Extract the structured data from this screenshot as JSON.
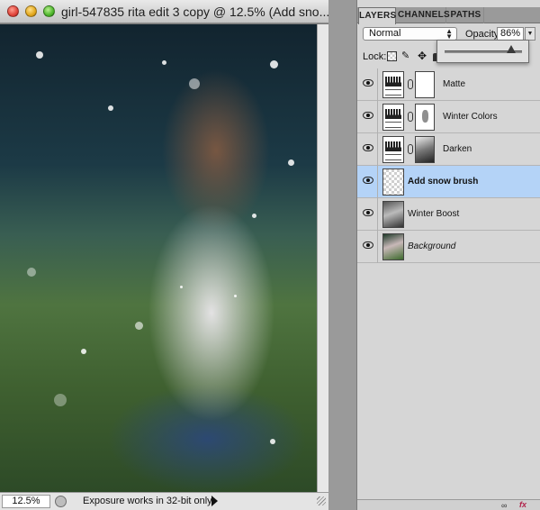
{
  "document": {
    "title": "girl-547835 rita edit 3 copy @ 12.5% (Add sno...",
    "status": {
      "zoom": "12.5%",
      "message": "Exposure works in 32-bit only"
    }
  },
  "panel": {
    "tabs": [
      "LAYERS",
      "CHANNELS",
      "PATHS"
    ],
    "active_tab": "LAYERS",
    "blend_mode": "Normal",
    "opacity_label": "Opacity:",
    "opacity_value": "86%",
    "opacity_fraction": 0.86,
    "lock_label": "Lock:",
    "layers": [
      {
        "name": "Matte",
        "kind": "adjustment",
        "mask": "white"
      },
      {
        "name": "Winter Colors",
        "kind": "adjustment",
        "mask": "shape"
      },
      {
        "name": "Darken",
        "kind": "adjustment",
        "mask": "photo"
      },
      {
        "name": "Add snow brush",
        "kind": "pixel-transparent",
        "selected": true
      },
      {
        "name": "Winter Boost",
        "kind": "pixel-photo"
      },
      {
        "name": "Background",
        "kind": "pixel-background"
      }
    ]
  },
  "colors": {
    "selection": "#b4d3f7",
    "panel_bg": "#d6d6d6",
    "fx": "#b1224a"
  },
  "icons": {
    "close": "close-icon",
    "minimize": "minimize-icon",
    "zoom": "zoom-icon",
    "visibility": "eye-icon",
    "link": "link-icon",
    "effects": "fx-icon"
  },
  "footer": {
    "fx_label": "fx"
  }
}
